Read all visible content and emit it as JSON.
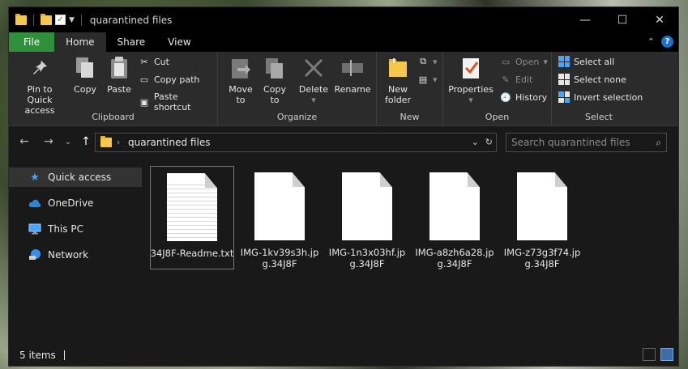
{
  "window": {
    "title": "quarantined files"
  },
  "ribbon_tabs": [
    "File",
    "Home",
    "Share",
    "View"
  ],
  "clipboard": {
    "pin_label_1": "Pin to Quick",
    "pin_label_2": "access",
    "copy": "Copy",
    "paste": "Paste",
    "cut": "Cut",
    "copy_path": "Copy path",
    "paste_shortcut": "Paste shortcut",
    "group": "Clipboard"
  },
  "organize": {
    "move_1": "Move",
    "move_2": "to",
    "copy_1": "Copy",
    "copy_2": "to",
    "delete": "Delete",
    "rename": "Rename",
    "group": "Organize"
  },
  "new": {
    "new_1": "New",
    "new_2": "folder",
    "group": "New"
  },
  "open": {
    "properties": "Properties",
    "open": "Open",
    "edit": "Edit",
    "history": "History",
    "group": "Open"
  },
  "select": {
    "select_all": "Select all",
    "select_none": "Select none",
    "invert": "Invert selection",
    "group": "Select"
  },
  "address": {
    "path": "quarantined files"
  },
  "search": {
    "placeholder": "Search quarantined files"
  },
  "sidebar": {
    "items": [
      {
        "label": "Quick access",
        "icon": "star-icon"
      },
      {
        "label": "OneDrive",
        "icon": "cloud-icon"
      },
      {
        "label": "This PC",
        "icon": "pc-icon"
      },
      {
        "label": "Network",
        "icon": "network-icon"
      }
    ]
  },
  "files": [
    {
      "name": "34J8F-Readme.txt"
    },
    {
      "name": "IMG-1kv39s3h.jpg.34J8F"
    },
    {
      "name": "IMG-1n3x03hf.jpg.34J8F"
    },
    {
      "name": "IMG-a8zh6a28.jpg.34J8F"
    },
    {
      "name": "IMG-z73g3f74.jpg.34J8F"
    }
  ],
  "status": {
    "items": "5 items"
  },
  "colors": {
    "file_tab": "#2f8f3a",
    "accent": "#4aa3ff",
    "folder": "#f5c84c"
  }
}
